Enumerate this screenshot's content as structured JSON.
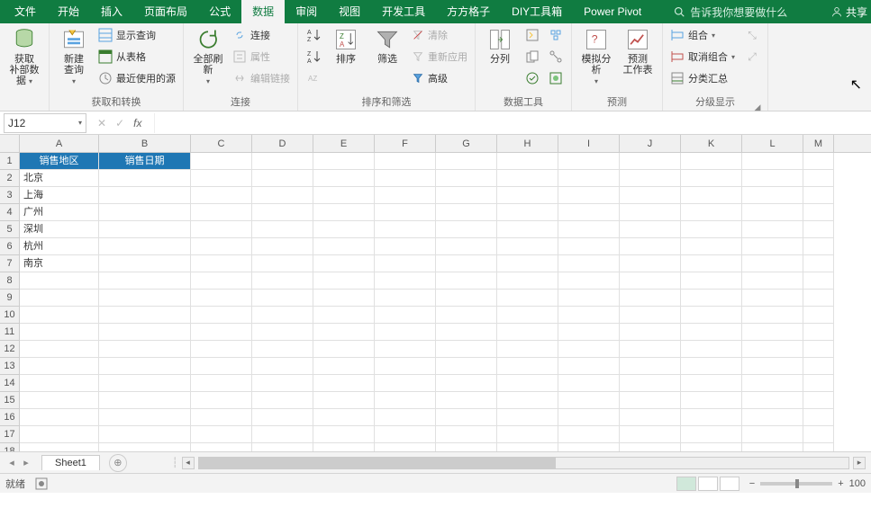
{
  "tabs": {
    "file": "文件",
    "home": "开始",
    "insert": "插入",
    "layout": "页面布局",
    "formulas": "公式",
    "data": "数据",
    "review": "审阅",
    "view": "视图",
    "developer": "开发工具",
    "ffgz": "方方格子",
    "diy": "DIY工具箱",
    "pp": "Power Pivot"
  },
  "tellme": "告诉我你想要做什么",
  "share": "共享",
  "groups": {
    "ext": {
      "label": "补部数据",
      "btn": "获取"
    },
    "gt": {
      "label": "获取和转换",
      "new": "新建\n查询",
      "show": "显示查询",
      "table": "从表格",
      "recent": "最近使用的源"
    },
    "conn": {
      "label": "连接",
      "refresh": "全部刷新",
      "c1": "连接",
      "c2": "属性",
      "c3": "编辑链接"
    },
    "sort": {
      "label": "排序和筛选",
      "az": "排序",
      "filter": "筛选",
      "clear": "清除",
      "reapply": "重新应用",
      "adv": "高级"
    },
    "dt": {
      "label": "数据工具",
      "split": "分列"
    },
    "fc": {
      "label": "预测",
      "what": "模拟分析",
      "sheet": "预测\n工作表"
    },
    "outline": {
      "label": "分级显示",
      "group": "组合",
      "ungroup": "取消组合",
      "subtotal": "分类汇总"
    }
  },
  "namebox": "J12",
  "columns": [
    "A",
    "B",
    "C",
    "D",
    "E",
    "F",
    "G",
    "H",
    "I",
    "J",
    "K",
    "L",
    "M"
  ],
  "colw": [
    "wA",
    "wB",
    "wC",
    "wD",
    "wE",
    "wF",
    "wG",
    "wH",
    "wI",
    "wJ",
    "wK",
    "wL",
    "wM"
  ],
  "sheet_data": {
    "header": [
      "销售地区",
      "销售日期"
    ],
    "rows": [
      "北京",
      "上海",
      "广州",
      "深圳",
      "杭州",
      "南京"
    ]
  },
  "sheettab": "Sheet1",
  "status": "就绪",
  "zoom": "100"
}
